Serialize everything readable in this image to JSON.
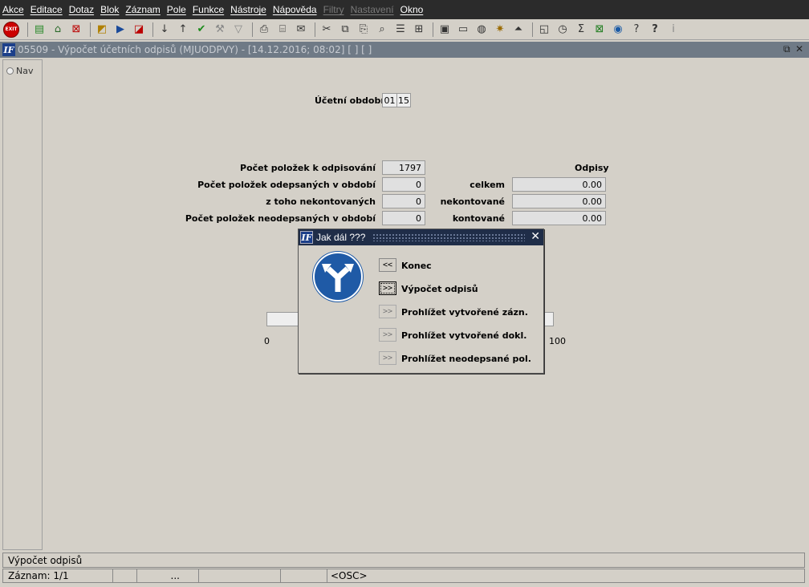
{
  "menu": {
    "items": [
      {
        "label": "Akce",
        "disabled": false
      },
      {
        "label": "Editace",
        "disabled": false
      },
      {
        "label": "Dotaz",
        "disabled": false
      },
      {
        "label": "Blok",
        "disabled": false
      },
      {
        "label": "Záznam",
        "disabled": false
      },
      {
        "label": "Pole",
        "disabled": false
      },
      {
        "label": "Funkce",
        "disabled": false
      },
      {
        "label": "Nástroje",
        "disabled": false
      },
      {
        "label": "Nápověda",
        "disabled": false
      },
      {
        "label": "Filtry",
        "disabled": true
      },
      {
        "label": "Nastavení",
        "disabled": true
      },
      {
        "label": "Okno",
        "disabled": false
      }
    ]
  },
  "toolbar": {
    "exit_label": "EXIT"
  },
  "window": {
    "title": "05509 - Výpočet účetních odpisů (MJUODPVY) - [14.12.2016; 08:02] [ ] [ ]"
  },
  "nav": {
    "label": "Nav"
  },
  "form": {
    "period_label": "Účetní období",
    "period_month": "01",
    "period_year": "15",
    "count_label": "Počet položek k odpisování",
    "count_value": "1797",
    "written_label": "Počet položek odepsaných v období",
    "written_value": "0",
    "unposted_label": "z toho nekontovaných",
    "unposted_value": "0",
    "notwritten_label": "Počet položek neodepsaných v období",
    "notwritten_value": "0",
    "odpisy_heading": "Odpisy",
    "total_label": "celkem",
    "total_value": "0.00",
    "nekont_label": "nekontované",
    "nekont_value": "0.00",
    "kont_label": "kontované",
    "kont_value": "0.00",
    "progress_min": "0",
    "progress_max": "100"
  },
  "dialog": {
    "title": "Jak dál ???",
    "options": [
      {
        "button": "<<",
        "label": "Konec"
      },
      {
        "button": ">>",
        "label": "Výpočet odpisů"
      },
      {
        "button": ">>",
        "label": "Prohlížet vytvořené zázn."
      },
      {
        "button": ">>",
        "label": "Prohlížet vytvořené dokl."
      },
      {
        "button": ">>",
        "label": "Prohlížet neodepsané pol."
      }
    ]
  },
  "status": {
    "message": "Výpočet odpisů",
    "record": "Záznam: 1/1",
    "seg_dots": "...",
    "mode": "<OSC>"
  }
}
